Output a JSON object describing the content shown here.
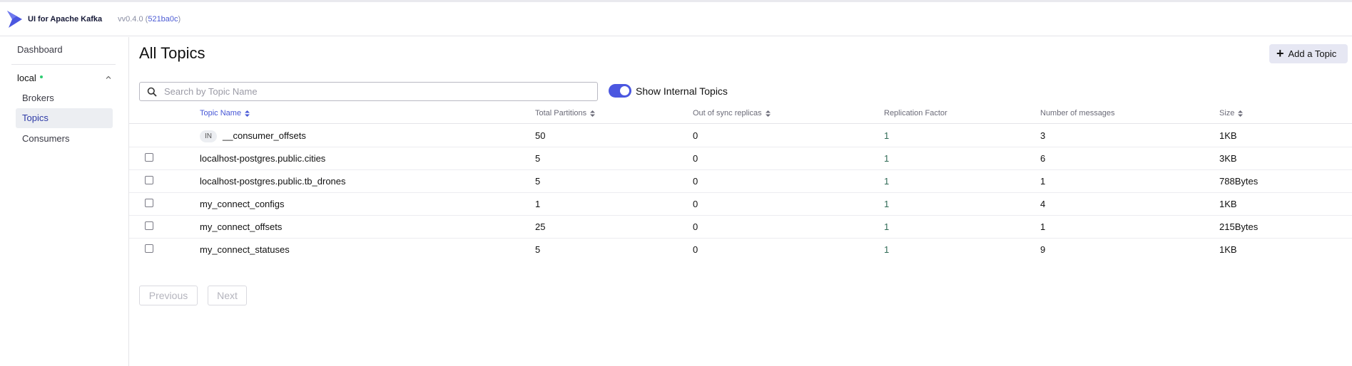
{
  "app": {
    "brand": "UI for Apache Kafka",
    "version": "vv0.4.0",
    "commit": "521ba0c",
    "logo_icon": "kafka-logo-icon"
  },
  "sidebar": {
    "dashboard_label": "Dashboard",
    "cluster": {
      "name": "local",
      "status": "online",
      "expanded": true
    },
    "items": [
      {
        "label": "Brokers",
        "active": false
      },
      {
        "label": "Topics",
        "active": true
      },
      {
        "label": "Consumers",
        "active": false
      }
    ]
  },
  "main": {
    "title": "All Topics",
    "add_button_label": "Add a Topic",
    "search": {
      "placeholder": "Search by Topic Name",
      "value": ""
    },
    "show_internal": {
      "label": "Show Internal Topics",
      "checked": true
    }
  },
  "table": {
    "headers": [
      "Topic Name",
      "Total Partitions",
      "Out of sync replicas",
      "Replication Factor",
      "Number of messages",
      "Size"
    ],
    "rows": [
      {
        "internal": true,
        "badge": "IN",
        "name": "__consumer_offsets",
        "partitions": "50",
        "out_of_sync": "0",
        "replication": "1",
        "messages": "3",
        "size": "1KB"
      },
      {
        "internal": false,
        "badge": "",
        "name": "localhost-postgres.public.cities",
        "partitions": "5",
        "out_of_sync": "0",
        "replication": "1",
        "messages": "6",
        "size": "3KB"
      },
      {
        "internal": false,
        "badge": "",
        "name": "localhost-postgres.public.tb_drones",
        "partitions": "5",
        "out_of_sync": "0",
        "replication": "1",
        "messages": "1",
        "size": "788Bytes"
      },
      {
        "internal": false,
        "badge": "",
        "name": "my_connect_configs",
        "partitions": "1",
        "out_of_sync": "0",
        "replication": "1",
        "messages": "4",
        "size": "1KB"
      },
      {
        "internal": false,
        "badge": "",
        "name": "my_connect_offsets",
        "partitions": "25",
        "out_of_sync": "0",
        "replication": "1",
        "messages": "1",
        "size": "215Bytes"
      },
      {
        "internal": false,
        "badge": "",
        "name": "my_connect_statuses",
        "partitions": "5",
        "out_of_sync": "0",
        "replication": "1",
        "messages": "9",
        "size": "1KB"
      }
    ]
  },
  "pagination": {
    "previous_label": "Previous",
    "next_label": "Next"
  },
  "colors": {
    "accent": "#4b57e0",
    "active_link": "#2d3aa6",
    "replication": "#2f6a55"
  }
}
